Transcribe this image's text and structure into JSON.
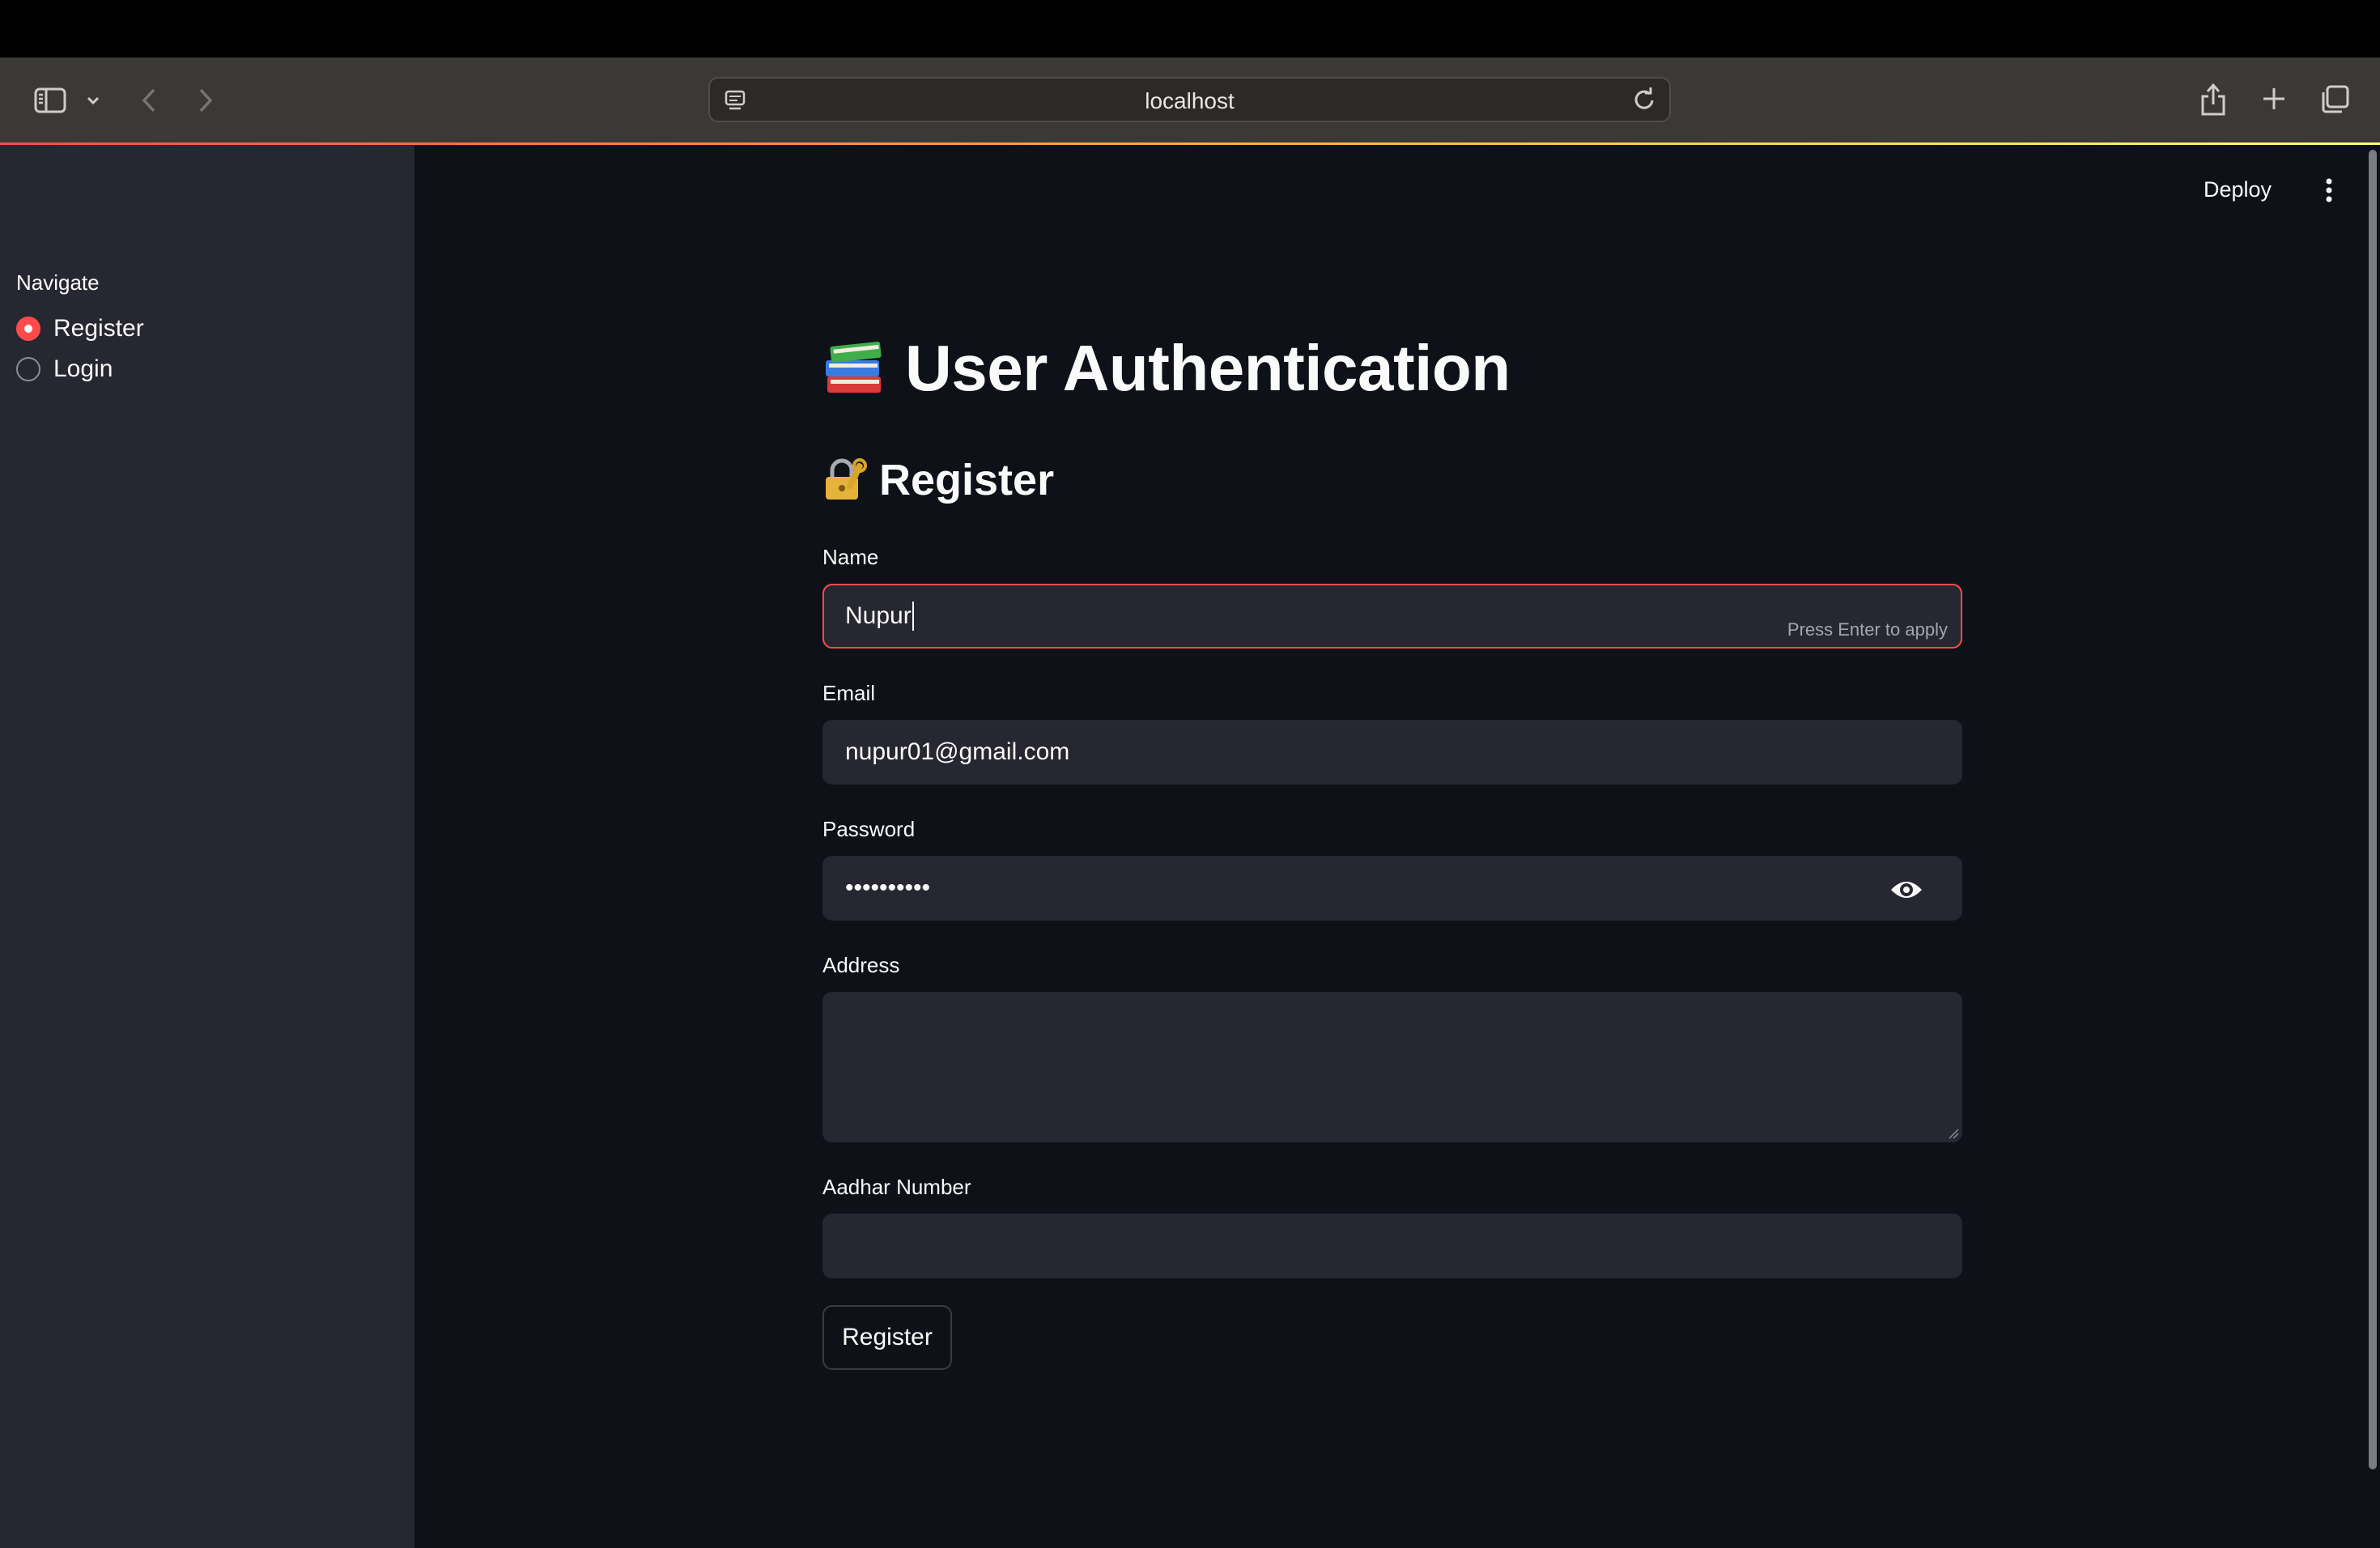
{
  "browser": {
    "url": "localhost"
  },
  "app": {
    "deploy_label": "Deploy",
    "sidebar": {
      "navigate_label": "Navigate",
      "options": [
        {
          "label": "Register",
          "selected": true
        },
        {
          "label": "Login",
          "selected": false
        }
      ]
    },
    "title": "User Authentication",
    "subtitle": "Register",
    "form": {
      "name": {
        "label": "Name",
        "value": "Nupur",
        "hint": "Press Enter to apply"
      },
      "email": {
        "label": "Email",
        "value": "nupur01@gmail.com"
      },
      "password": {
        "label": "Password",
        "masked_value": "••••••••••"
      },
      "address": {
        "label": "Address",
        "value": ""
      },
      "aadhar": {
        "label": "Aadhar Number",
        "value": ""
      },
      "submit_label": "Register"
    }
  },
  "colors": {
    "accent": "#ff4b4b",
    "app_bg": "#0e1117",
    "sidebar_bg": "#262730",
    "input_bg": "#262730",
    "toolbar_bg": "#3a3936"
  },
  "icons": {
    "title_emoji": "books-icon",
    "subtitle_emoji": "lock-with-key-icon"
  }
}
